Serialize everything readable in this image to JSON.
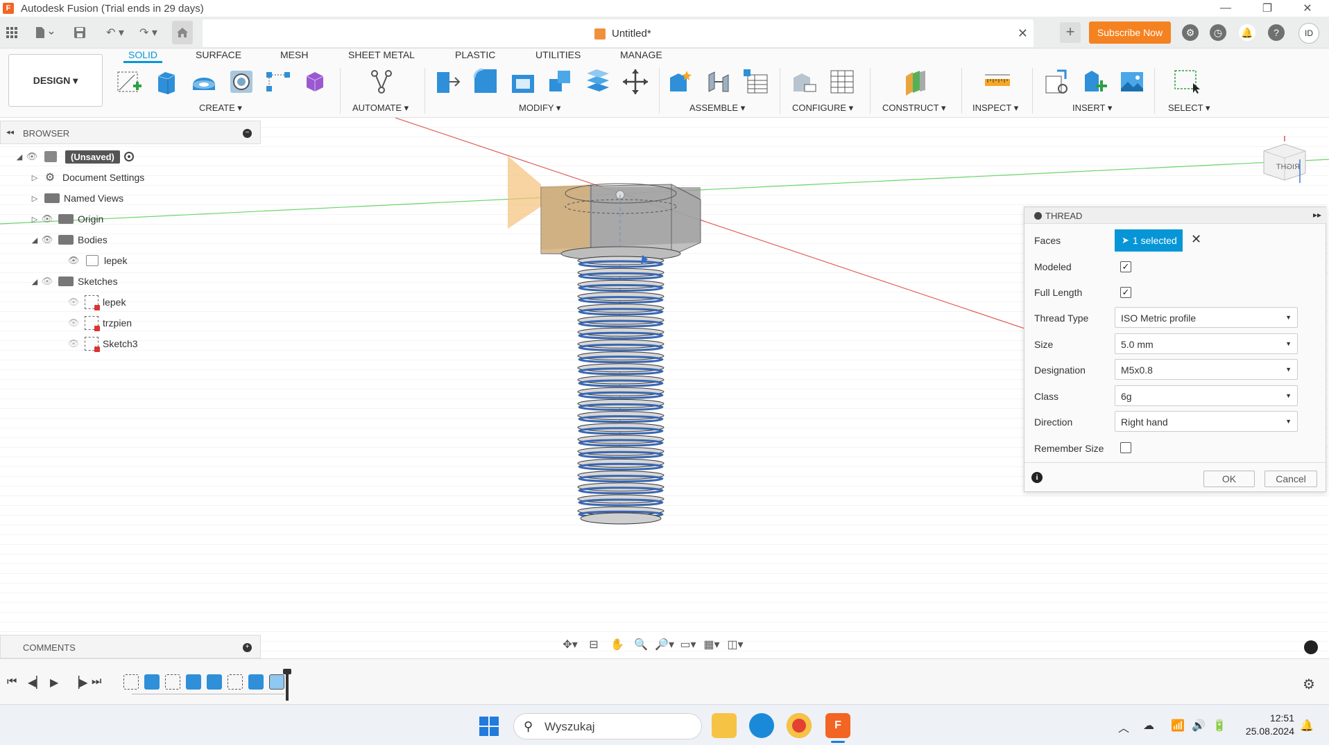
{
  "window": {
    "title": "Autodesk Fusion (Trial ends in 29 days)",
    "app_icon_letter": "F",
    "controls": [
      "—",
      "❐",
      "✕"
    ]
  },
  "tabbar": {
    "doc_title": "Untitled*",
    "close_symbol": "✕",
    "new_tab_symbol": "+",
    "subscribe_label": "Subscribe Now",
    "user_initials": "ID",
    "help_symbol": "?"
  },
  "toolbar": {
    "workspace_label": "DESIGN ▾",
    "tabs": [
      "SOLID",
      "SURFACE",
      "MESH",
      "SHEET METAL",
      "PLASTIC",
      "UTILITIES",
      "MANAGE"
    ],
    "groups": [
      "CREATE ▾",
      "AUTOMATE ▾",
      "MODIFY ▾",
      "ASSEMBLE ▾",
      "CONFIGURE ▾",
      "CONSTRUCT ▾",
      "INSPECT ▾",
      "INSERT ▾",
      "SELECT ▾"
    ]
  },
  "browser": {
    "header": "BROWSER",
    "root": "(Unsaved)",
    "items": [
      {
        "label": "Document Settings"
      },
      {
        "label": "Named Views"
      },
      {
        "label": "Origin"
      },
      {
        "label": "Bodies"
      },
      {
        "label": "lepek"
      },
      {
        "label": "Sketches"
      },
      {
        "label": "lepek"
      },
      {
        "label": "trzpien"
      },
      {
        "label": "Sketch3"
      }
    ]
  },
  "thread_dialog": {
    "title": "THREAD",
    "faces_label": "Faces",
    "faces_value": "1 selected",
    "modeled_label": "Modeled",
    "modeled_checked": true,
    "full_length_label": "Full Length",
    "full_length_checked": true,
    "thread_type_label": "Thread Type",
    "thread_type_value": "ISO Metric profile",
    "size_label": "Size",
    "size_value": "5.0 mm",
    "designation_label": "Designation",
    "designation_value": "M5x0.8",
    "class_label": "Class",
    "class_value": "6g",
    "direction_label": "Direction",
    "direction_value": "Right hand",
    "remember_label": "Remember Size",
    "remember_checked": false,
    "ok_label": "OK",
    "cancel_label": "Cancel",
    "info_symbol": "i"
  },
  "viewcube": {
    "face_label": "RIGHT"
  },
  "comments": {
    "header": "COMMENTS"
  },
  "taskbar": {
    "search_placeholder": "Wyszukaj",
    "time": "12:51",
    "date": "25.08.2024"
  },
  "colors": {
    "accent": "#0696d7",
    "subscribe": "#f58220",
    "x_axis": "#e05050",
    "y_axis": "#40c040",
    "thread_blue": "#3a67b0"
  }
}
